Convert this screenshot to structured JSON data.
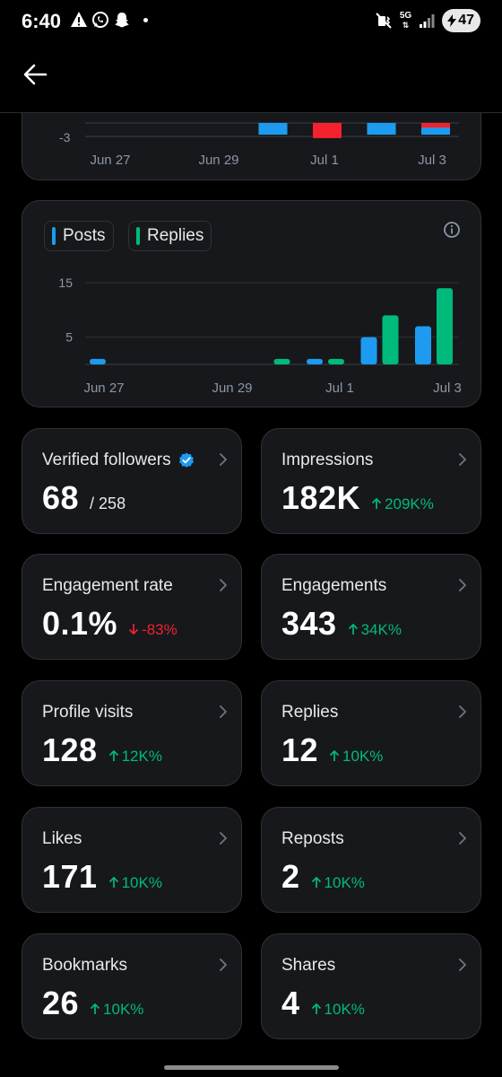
{
  "status_bar": {
    "time": "6:40",
    "network": "5G",
    "battery": "47"
  },
  "chart_top": {
    "y_tick": "-3",
    "x_labels": [
      "Jun 27",
      "Jun 29",
      "Jul 1",
      "Jul 3"
    ]
  },
  "chart_data": [
    {
      "type": "bar",
      "categories": [
        "Jun 27",
        "Jun 28",
        "Jun 29",
        "Jun 30",
        "Jul 1",
        "Jul 2",
        "Jul 3"
      ],
      "series": [
        {
          "name": "",
          "color": "#1d9bf0",
          "values": [
            0,
            0,
            0,
            -1,
            0,
            -1,
            -1
          ]
        },
        {
          "name": "",
          "color": "#f4212e",
          "values": [
            0,
            0,
            0,
            0,
            -1.3,
            0,
            -0.4
          ]
        }
      ],
      "yticks": [
        "-3"
      ],
      "xlabel": "",
      "ylabel": ""
    },
    {
      "type": "bar",
      "categories": [
        "Jun 27",
        "Jun 28",
        "Jun 29",
        "Jun 30",
        "Jul 1",
        "Jul 2",
        "Jul 3"
      ],
      "series": [
        {
          "name": "Posts",
          "color": "#1d9bf0",
          "values": [
            1,
            0,
            0,
            0,
            1,
            5,
            7
          ]
        },
        {
          "name": "Replies",
          "color": "#00ba7c",
          "values": [
            0,
            0,
            0,
            1,
            1,
            9,
            14
          ]
        }
      ],
      "yticks": [
        "15",
        "5"
      ],
      "ylim": [
        0,
        15
      ],
      "xlabel": "",
      "ylabel": ""
    }
  ],
  "legend": {
    "posts": "Posts",
    "replies": "Replies"
  },
  "stats": [
    {
      "label": "Verified followers",
      "value": "68",
      "sub": "/ 258",
      "verified": true
    },
    {
      "label": "Impressions",
      "value": "182K",
      "change": "209K%",
      "dir": "up"
    },
    {
      "label": "Engagement rate",
      "value": "0.1%",
      "change": "-83%",
      "dir": "down"
    },
    {
      "label": "Engagements",
      "value": "343",
      "change": "34K%",
      "dir": "up"
    },
    {
      "label": "Profile visits",
      "value": "128",
      "change": "12K%",
      "dir": "up"
    },
    {
      "label": "Replies",
      "value": "12",
      "change": "10K%",
      "dir": "up"
    },
    {
      "label": "Likes",
      "value": "171",
      "change": "10K%",
      "dir": "up"
    },
    {
      "label": "Reposts",
      "value": "2",
      "change": "10K%",
      "dir": "up"
    },
    {
      "label": "Bookmarks",
      "value": "26",
      "change": "10K%",
      "dir": "up"
    },
    {
      "label": "Shares",
      "value": "4",
      "change": "10K%",
      "dir": "up"
    }
  ],
  "colors": {
    "accent": "#1d9bf0",
    "positive": "#00ba7c",
    "negative": "#f4212e",
    "card": "#16181c"
  }
}
